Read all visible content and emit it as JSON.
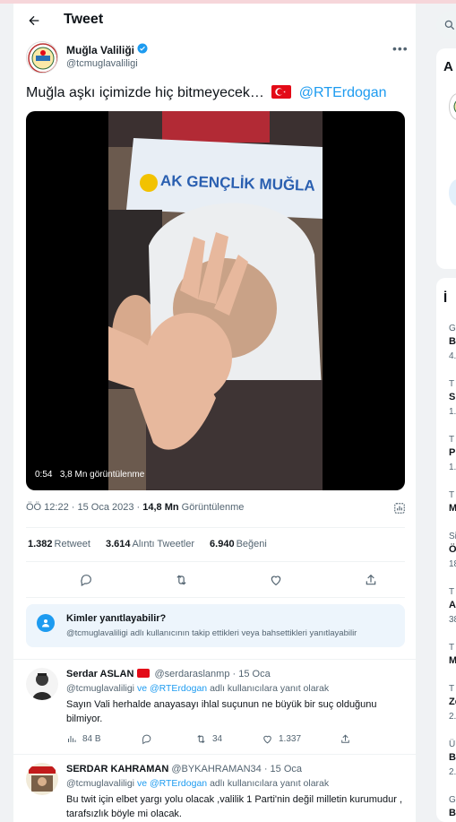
{
  "header": {
    "title": "Tweet"
  },
  "tweet": {
    "display_name": "Muğla Valiliği",
    "handle": "@tcmuglavaliligi",
    "text": "Muğla aşkı içimizde hiç bitmeyecek…",
    "mention": "@RTErdogan",
    "video": {
      "banner": "AK GENÇLİK MUĞLA",
      "duration": "0:54",
      "views_overlay": "3,8 Mn görüntülenme"
    },
    "time": "ÖÖ 12:22 · 15 Oca 2023",
    "views_count": "14,8 Mn",
    "views_label": "Görüntülenme",
    "retweets_count": "1.382",
    "retweets_label": "Retweet",
    "quotes_count": "3.614",
    "quotes_label": "Alıntı Tweetler",
    "likes_count": "6.940",
    "likes_label": "Beğeni"
  },
  "reply_restriction": {
    "title": "Kimler yanıtlayabilir?",
    "text": "@tcmuglavaliligi adlı kullanıcının takip ettikleri veya bahsettikleri yanıtlayabilir"
  },
  "replies": [
    {
      "name": "Serdar ASLAN",
      "handle": "@serdaraslanmp",
      "date": "· 15 Oca",
      "reply_to_prefix": "@tcmuglavaliligi",
      "reply_to_and": "ve",
      "reply_to_second": "@RTErdogan",
      "reply_to_suffix": "adlı kullanıcılara yanıt olarak",
      "text": "Sayın Vali herhalde anayasayı ihlal suçunun ne büyük bir suç olduğunu bilmiyor.",
      "views": "84 B",
      "retweets": "34",
      "likes": "1.337"
    },
    {
      "name": "SERDAR KAHRAMAN",
      "handle": "@BYKAHRAMAN34",
      "date": "· 15 Oca",
      "reply_to_prefix": "@tcmuglavaliligi",
      "reply_to_and": "ve",
      "reply_to_second": "@RTErdogan",
      "reply_to_suffix": "adlı kullanıcılara yanıt olarak",
      "text": "Bu twit için elbet yargı yolu olacak ,valilik 1 Parti'nin değil milletin kurumudur , tarafsızlık böyle mi olacak."
    }
  ],
  "right_sidebar": {
    "card1_letter": "A",
    "trends_title_letter": "İ",
    "trends": [
      {
        "cat": "G",
        "name": "B",
        "count": "4."
      },
      {
        "cat": "T",
        "name": "S",
        "count": "1."
      },
      {
        "cat": "T",
        "name": "P",
        "count": "1."
      },
      {
        "cat": "T",
        "name": "M",
        "count": ""
      },
      {
        "cat": "Si",
        "name": "Ö",
        "count": "18"
      },
      {
        "cat": "T",
        "name": "A",
        "count": "38"
      },
      {
        "cat": "T",
        "name": "M",
        "count": ""
      },
      {
        "cat": "T",
        "name": "Ze",
        "count": "2."
      },
      {
        "cat": "Ü",
        "name": "B",
        "count": "2."
      },
      {
        "cat": "G",
        "name": "B",
        "count": ""
      }
    ]
  },
  "colors": {
    "accent": "#1d9bf0",
    "text": "#0f1419",
    "muted": "#536471"
  }
}
